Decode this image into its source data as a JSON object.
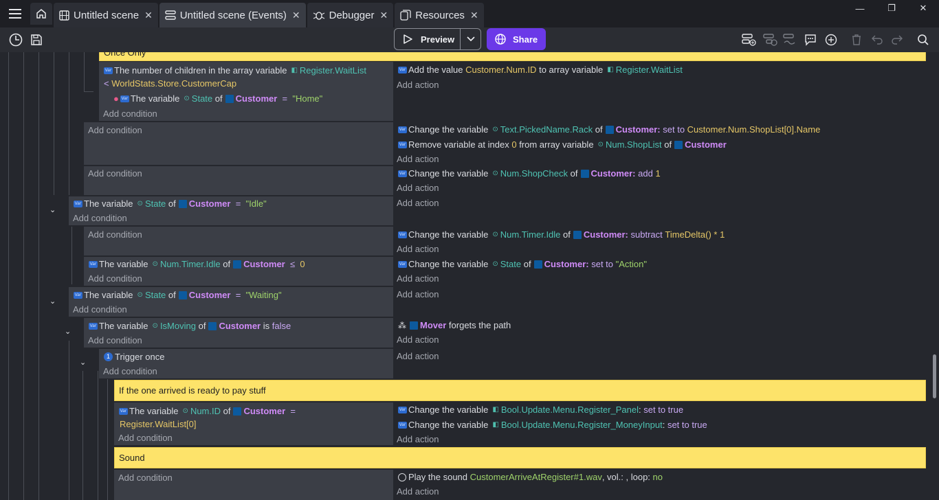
{
  "tabs": [
    {
      "label": "Untitled scene",
      "icon": "film-icon"
    },
    {
      "label": "Untitled scene (Events)",
      "icon": "events-icon"
    },
    {
      "label": "Debugger",
      "icon": "bug-icon"
    },
    {
      "label": "Resources",
      "icon": "resources-icon"
    }
  ],
  "window": {
    "minimize": "—",
    "restore": "❐",
    "close": "✕"
  },
  "toolbar": {
    "preview_label": "Preview",
    "share_label": "Share"
  },
  "events": {
    "top_comment": "Once Only",
    "e1": {
      "c1_text": "The number of children in the array variable",
      "c1_var": "Register.WaitList",
      "c1_cmp": "<",
      "c1_val": "WorldStats.Store.CustomerCap",
      "c2_pre": "The variable",
      "c2_var": "State",
      "c2_of": "of",
      "c2_obj": "Customer",
      "c2_eq": "=",
      "c2_val": "\"Home\"",
      "a1_text": "Add the value",
      "a1_val": "Customer.Num.ID",
      "a1_mid": "to array variable",
      "a1_var": "Register.WaitList"
    },
    "e2": {
      "a1_pre": "Change the variable",
      "a1_var": "Text.PickedName.Rack",
      "a1_of": "of",
      "a1_obj": "Customer:",
      "a1_op": "set to",
      "a1_val": "Customer.Num.ShopList[0].Name",
      "a2_pre": "Remove variable at index",
      "a2_idx": "0",
      "a2_mid": "from array variable",
      "a2_var": "Num.ShopList",
      "a2_of": "of",
      "a2_obj": "Customer"
    },
    "e3": {
      "a1_pre": "Change the variable",
      "a1_var": "Num.ShopCheck",
      "a1_of": "of",
      "a1_obj": "Customer:",
      "a1_op": "add",
      "a1_val": "1"
    },
    "e4": {
      "c_pre": "The variable",
      "c_var": "State",
      "c_of": "of",
      "c_obj": "Customer",
      "c_eq": "=",
      "c_val": "\"Idle\""
    },
    "e5": {
      "a1_pre": "Change the variable",
      "a1_var": "Num.Timer.Idle",
      "a1_of": "of",
      "a1_obj": "Customer:",
      "a1_op": "subtract",
      "a1_val": "TimeDelta() * 1"
    },
    "e6": {
      "c_pre": "The variable",
      "c_var": "Num.Timer.Idle",
      "c_of": "of",
      "c_obj": "Customer",
      "c_cmp": "≤",
      "c_val": "0",
      "a1_pre": "Change the variable",
      "a1_var": "State",
      "a1_of": "of",
      "a1_obj": "Customer:",
      "a1_op": "set to",
      "a1_val": "\"Action\""
    },
    "e7": {
      "c_pre": "The variable",
      "c_var": "State",
      "c_of": "of",
      "c_obj": "Customer",
      "c_eq": "=",
      "c_val": "\"Waiting\""
    },
    "e8": {
      "c_pre": "The variable",
      "c_var": "IsMoving",
      "c_of": "of",
      "c_obj": "Customer",
      "c_is": "is",
      "c_val": "false",
      "a1_obj": "Mover",
      "a1_text": "forgets the path"
    },
    "e9": {
      "c_text": "Trigger once"
    },
    "comment2": "If the one arrived is ready to pay stuff",
    "e10": {
      "c_pre": "The variable",
      "c_var": "Num.ID",
      "c_of": "of",
      "c_obj": "Customer",
      "c_eq": "=",
      "c_val": "Register.WaitList[0]",
      "a1_pre": "Change the variable",
      "a1_var": "Bool.Update.Menu.Register_Panel",
      "a1_op": "set to true",
      "a2_pre": "Change the variable",
      "a2_var": "Bool.Update.Menu.Register_MoneyInput",
      "a2_op": "set to true"
    },
    "comment3": "Sound",
    "e11": {
      "a1_pre": "Play the sound",
      "a1_val": "CustomerArriveAtRegister#1.wav",
      "a1_vol": ", vol.: , loop:",
      "a1_loop": "no"
    },
    "add_condition": "Add condition",
    "add_action": "Add action"
  }
}
